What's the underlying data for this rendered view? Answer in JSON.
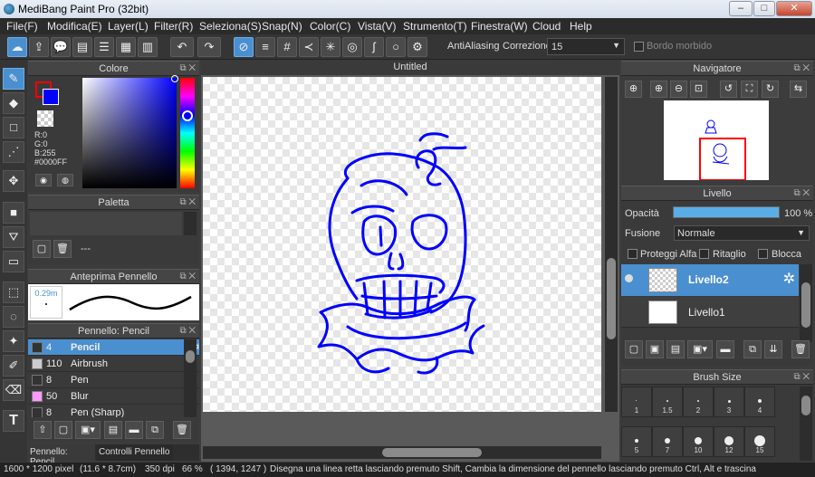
{
  "app": {
    "title": "MediBang Paint Pro (32bit)"
  },
  "window_controls": {
    "minimize": "–",
    "maximize": "□",
    "close": "✕"
  },
  "menu": [
    "File(F)",
    "Modifica(E)",
    "Layer(L)",
    "Filter(R)",
    "Seleziona(S)",
    "Snap(N)",
    "Color(C)",
    "Vista(V)",
    "Strumento(T)",
    "Finestra(W)",
    "Cloud",
    "Help"
  ],
  "toolbar": {
    "antialiasing_label": "AntiAliasing",
    "correction_label": "Correzione",
    "correction_value": "15",
    "soft_edge_label": "Bordo morbido"
  },
  "canvas": {
    "tab_title": "Untitled"
  },
  "color_panel": {
    "title": "Colore",
    "r": "R:0",
    "g": "G:0",
    "b": "B:255",
    "hex": "#0000FF",
    "primary": "#ff0000",
    "secondary": "#0000ff"
  },
  "palette_panel": {
    "title": "Paletta",
    "item": "---"
  },
  "brush_preview": {
    "title": "Anteprima Pennello",
    "size": "0.29m"
  },
  "brush_panel": {
    "title": "Pennello: Pencil",
    "rows": [
      {
        "size": "4",
        "name": "Pencil",
        "swatch": "#333333",
        "selected": true
      },
      {
        "size": "110",
        "name": "Airbrush",
        "swatch": "#cccccc",
        "selected": false
      },
      {
        "size": "8",
        "name": "Pen",
        "swatch": "#333333",
        "selected": false
      },
      {
        "size": "50",
        "name": "Blur",
        "swatch": "#ff99ff",
        "selected": false
      },
      {
        "size": "8",
        "name": "Pen (Sharp)",
        "swatch": "#333333",
        "selected": false
      }
    ]
  },
  "bottom_tabs": {
    "tab1": "Pennello: Pencil",
    "tab2": "Controlli Pennello"
  },
  "navigator": {
    "title": "Navigatore"
  },
  "layer_panel": {
    "title": "Livello",
    "opacity_label": "Opacità",
    "opacity_value": "100 %",
    "opacity_fraction": 1.0,
    "blend_label": "Fusione",
    "blend_value": "Normale",
    "protect_alpha": "Proteggi Alfa",
    "clipping": "Ritaglio",
    "lock": "Blocca",
    "layers": [
      {
        "name": "Livello2",
        "selected": true
      },
      {
        "name": "Livello1",
        "selected": false
      }
    ]
  },
  "brush_size_panel": {
    "title": "Brush Size",
    "sizes": [
      "1",
      "1.5",
      "2",
      "3",
      "4",
      "5",
      "7",
      "10",
      "12",
      "15"
    ]
  },
  "status": {
    "dimensions": "1600 * 1200 pixel",
    "physical": "(11.6 * 8.7cm)",
    "dpi": "350 dpi",
    "zoom": "66 %",
    "coords": "( 1394, 1247 )",
    "hint": "Disegna una linea retta lasciando premuto Shift, Cambia la dimensione del pennello lasciando premuto Ctrl, Alt e trascina"
  },
  "colors": {
    "accent": "#4a90d0",
    "ink": "#0000ff"
  }
}
